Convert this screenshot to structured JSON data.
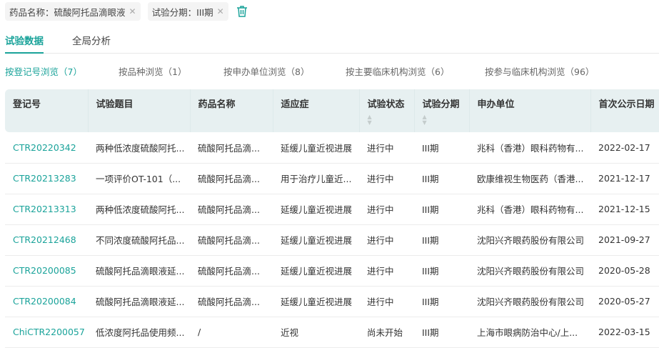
{
  "filters": [
    {
      "label": "药品名称：硫酸阿托品滴眼液"
    },
    {
      "label": "试验分期：III期"
    }
  ],
  "tabs": [
    "试验数据",
    "全局分析"
  ],
  "browse": [
    "按登记号浏览（7）",
    "按品种浏览（1）",
    "按申办单位浏览（8）",
    "按主要临床机构浏览（6）",
    "按参与临床机构浏览（96）"
  ],
  "columns": [
    "登记号",
    "试验题目",
    "药品名称",
    "适应症",
    "试验状态",
    "试验分期",
    "申办单位",
    "首次公示日期"
  ],
  "rows": [
    [
      "CTR20220342",
      "两种低浓度硫酸阿托...",
      "硫酸阿托品滴...",
      "延缓儿童近视进展",
      "进行中",
      "III期",
      "兆科（香港）眼科药物有...",
      "2022-02-17"
    ],
    [
      "CTR20213283",
      "一项评价OT-101（...",
      "硫酸阿托品滴...",
      "用于治疗儿童近...",
      "进行中",
      "III期",
      "欧康维视生物医药（香港...",
      "2021-12-17"
    ],
    [
      "CTR20213313",
      "两种低浓度硫酸阿托...",
      "硫酸阿托品滴...",
      "延缓儿童近视进展",
      "进行中",
      "III期",
      "兆科（香港）眼科药物有...",
      "2021-12-15"
    ],
    [
      "CTR20212468",
      "不同浓度硫酸阿托品...",
      "硫酸阿托品滴...",
      "延缓儿童近视进展",
      "进行中",
      "III期",
      "沈阳兴齐眼药股份有限公司",
      "2021-09-27"
    ],
    [
      "CTR20200085",
      "硫酸阿托品滴眼液延...",
      "硫酸阿托品滴...",
      "延缓儿童近视进展",
      "进行中",
      "III期",
      "沈阳兴齐眼药股份有限公司",
      "2020-05-28"
    ],
    [
      "CTR20200084",
      "硫酸阿托品滴眼液延...",
      "硫酸阿托品滴...",
      "延缓儿童近视进展",
      "进行中",
      "III期",
      "沈阳兴齐眼药股份有限公司",
      "2020-05-27"
    ],
    [
      "ChiCTR2200057",
      "低浓度阿托品使用频...",
      "/",
      "近视",
      "尚未开始",
      "III期",
      "上海市眼病防治中心/上...",
      "2022-03-15"
    ]
  ],
  "accent": "#1aa39a"
}
